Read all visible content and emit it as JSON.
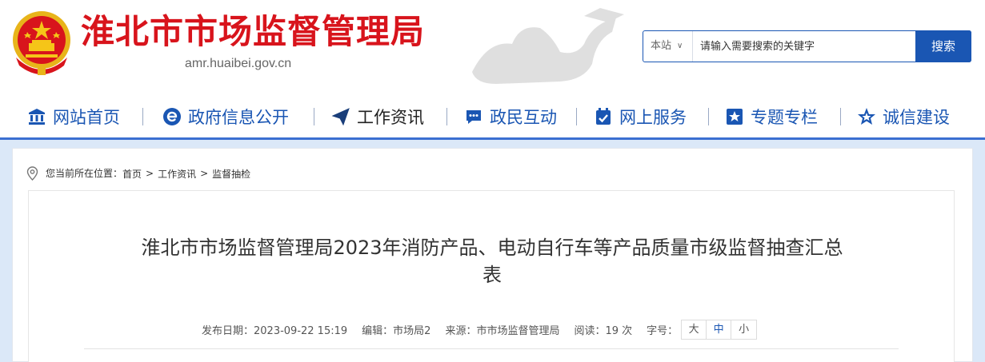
{
  "header": {
    "site_title": "淮北市市场监督管理局",
    "site_domain": "amr.huaibei.gov.cn",
    "emblem_icon": "national-emblem-icon",
    "decor_icon": "horse-sculpture-icon"
  },
  "search": {
    "scope": "本站",
    "placeholder": "请输入需要搜索的关键字",
    "button": "搜索"
  },
  "nav": {
    "items": [
      {
        "label": "网站首页",
        "icon": "bank-icon"
      },
      {
        "label": "政府信息公开",
        "icon": "e-icon"
      },
      {
        "label": "工作资讯",
        "icon": "paper-plane-icon"
      },
      {
        "label": "政民互动",
        "icon": "chat-icon"
      },
      {
        "label": "网上服务",
        "icon": "calendar-check-icon"
      },
      {
        "label": "专题专栏",
        "icon": "star-box-icon"
      },
      {
        "label": "诚信建设",
        "icon": "star-icon"
      }
    ],
    "active_index": 2
  },
  "breadcrumb": {
    "prefix": "您当前所在位置：",
    "items": [
      "首页",
      "工作资讯",
      "监督抽检"
    ],
    "separator": ">"
  },
  "article": {
    "title_line1": "淮北市市场监督管理局2023年消防产品、电动自行车等产品质量市级监督抽查汇总",
    "title_line2": "表",
    "meta": {
      "date": "发布日期：2023-09-22 15:19",
      "editor": "编辑：市场局2",
      "source": "来源：市市场监督管理局",
      "views": "阅读：19 次",
      "font_label": "字号："
    },
    "font_sizes": [
      "大",
      "中",
      "小"
    ],
    "font_active_index": 1
  },
  "colors": {
    "brand_red": "#d8141c",
    "brand_blue": "#1a56b3",
    "band_bg": "#dbe8f8"
  }
}
